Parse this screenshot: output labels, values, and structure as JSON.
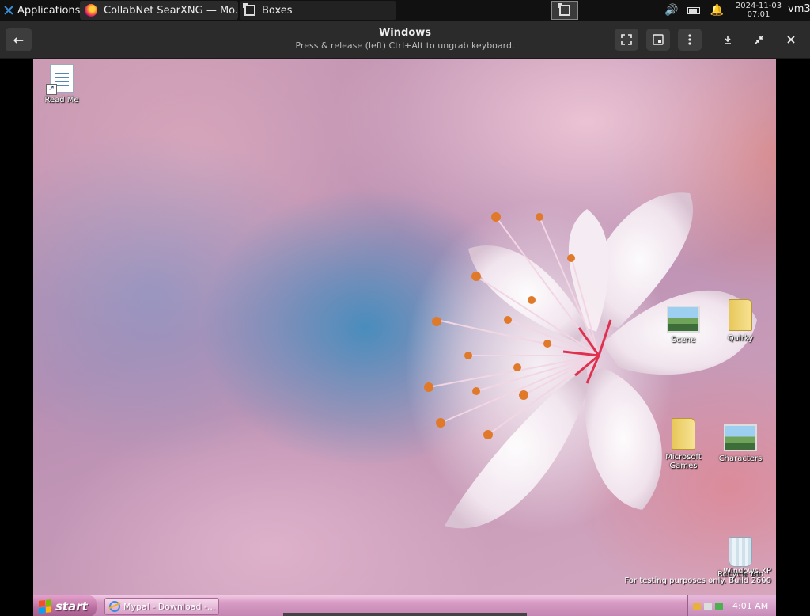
{
  "host_panel": {
    "applications_label": "Applications",
    "applications_suffix": "⋮",
    "tasks": [
      {
        "title": "CollabNet SearXNG — Mo...",
        "icon": "firefox-icon"
      },
      {
        "title": "Boxes",
        "icon": "boxes-icon"
      }
    ],
    "clock": {
      "date": "2024-11-03",
      "time": "07:01"
    },
    "user": "vm3"
  },
  "boxes_header": {
    "title": "Windows",
    "subtitle": "Press & release (left) Ctrl+Alt to ungrab keyboard.",
    "back_icon": "←",
    "buttons": [
      "fullscreen-icon",
      "screenshot-icon",
      "menu-icon",
      "minimize-icon",
      "restore-icon",
      "close-icon"
    ]
  },
  "guest": {
    "desktop_icons": [
      {
        "label": "Read Me",
        "type": "document"
      },
      {
        "label": "Scene",
        "type": "image"
      },
      {
        "label": "Quirky",
        "type": "folder"
      },
      {
        "label": "Microsoft Games",
        "type": "folder"
      },
      {
        "label": "Characters",
        "type": "image"
      },
      {
        "label": "Recycle Bin",
        "type": "recycle-bin"
      }
    ],
    "watermark": {
      "line1": "Windows XP",
      "line2": "For testing purposes only. Build 2600"
    },
    "taskbar": {
      "start_label": "start",
      "task_label": "Mypal - Download -...",
      "clock": "4:01 AM"
    },
    "colors": {
      "taskbar_top": "#f1c9e4",
      "taskbar_bottom": "#c486b2",
      "start_button": "#b86e9f"
    }
  }
}
